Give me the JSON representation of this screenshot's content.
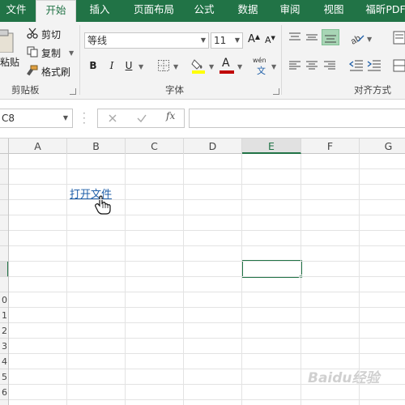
{
  "ribbon_tabs": [
    "文件",
    "开始",
    "插入",
    "页面布局",
    "公式",
    "数据",
    "审阅",
    "视图",
    "福昕PDF"
  ],
  "active_tab": "开始",
  "clipboard": {
    "paste_label": "粘贴",
    "cut_label": "剪切",
    "copy_label": "复制",
    "format_painter_label": "格式刷",
    "group_label": "剪贴板"
  },
  "font": {
    "name": "等线",
    "size": "11",
    "bold": "B",
    "italic": "I",
    "underline": "U",
    "font_color_glyph": "A",
    "phonetic_glyph": "wén",
    "group_label": "字体"
  },
  "alignment": {
    "group_label": "对齐方式"
  },
  "formula_bar": {
    "name_box": "C8",
    "fx": "fx",
    "formula": ""
  },
  "grid": {
    "columns": [
      "A",
      "B",
      "C",
      "D",
      "E",
      "F",
      "G"
    ],
    "selected_column": "E",
    "row_labels": [
      "",
      "",
      "",
      "",
      "",
      "",
      "",
      "",
      "",
      "0",
      "1",
      "2",
      "3",
      "4",
      "5",
      "6"
    ],
    "hyperlink_text": "打开文件"
  },
  "watermark": "Baidu经验",
  "colors": {
    "excel_green": "#217346",
    "ribbon_bg": "#f3f3f3",
    "hyperlink": "#1f5fa8",
    "highlight_yellow": "#ffff00",
    "font_red": "#c00000"
  }
}
